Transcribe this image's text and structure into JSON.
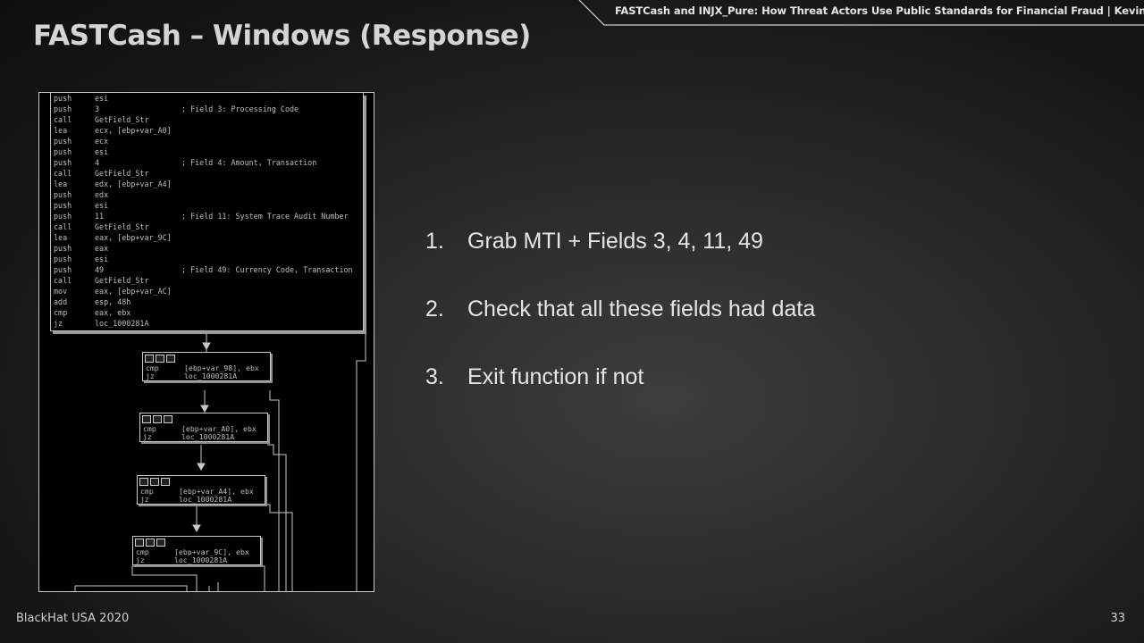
{
  "header": {
    "title": "FASTCash – Windows (Response)",
    "presentation_info": "FASTCash and INJX_Pure: How Threat Actors Use Public Standards for Financial Fraud | Kevin Perlow"
  },
  "footer": {
    "event": "BlackHat USA 2020",
    "page_number": "33"
  },
  "disassembly": {
    "main_block": [
      {
        "op": "push",
        "arg": "esi",
        "comment": ""
      },
      {
        "op": "push",
        "arg": "3",
        "comment": "; Field 3: Processing Code"
      },
      {
        "op": "call",
        "arg": "GetField_Str",
        "comment": ""
      },
      {
        "op": "lea",
        "arg": "ecx, [ebp+var_A0]",
        "comment": ""
      },
      {
        "op": "push",
        "arg": "ecx",
        "comment": ""
      },
      {
        "op": "push",
        "arg": "esi",
        "comment": ""
      },
      {
        "op": "push",
        "arg": "4",
        "comment": "; Field 4: Amount, Transaction"
      },
      {
        "op": "call",
        "arg": "GetField_Str",
        "comment": ""
      },
      {
        "op": "lea",
        "arg": "edx, [ebp+var_A4]",
        "comment": ""
      },
      {
        "op": "push",
        "arg": "edx",
        "comment": ""
      },
      {
        "op": "push",
        "arg": "esi",
        "comment": ""
      },
      {
        "op": "push",
        "arg": "11",
        "comment": "; Field 11: System Trace Audit Number"
      },
      {
        "op": "call",
        "arg": "GetField_Str",
        "comment": ""
      },
      {
        "op": "lea",
        "arg": "eax, [ebp+var_9C]",
        "comment": ""
      },
      {
        "op": "push",
        "arg": "eax",
        "comment": ""
      },
      {
        "op": "push",
        "arg": "esi",
        "comment": ""
      },
      {
        "op": "push",
        "arg": "49",
        "comment": "; Field 49: Currency Code, Transaction"
      },
      {
        "op": "call",
        "arg": "GetField_Str",
        "comment": ""
      },
      {
        "op": "mov",
        "arg": "eax, [ebp+var_AC]",
        "comment": ""
      },
      {
        "op": "add",
        "arg": "esp, 48h",
        "comment": ""
      },
      {
        "op": "cmp",
        "arg": "eax, ebx",
        "comment": ""
      },
      {
        "op": "jz",
        "arg": "loc_1000281A",
        "comment": ""
      }
    ],
    "nodes": [
      {
        "cmp": "cmp",
        "cmp_arg": "[ebp+var_98], ebx",
        "jz": "jz",
        "jz_arg": "loc_1000281A"
      },
      {
        "cmp": "cmp",
        "cmp_arg": "[ebp+var_A0], ebx",
        "jz": "jz",
        "jz_arg": "loc_1000281A"
      },
      {
        "cmp": "cmp",
        "cmp_arg": "[ebp+var_A4], ebx",
        "jz": "jz",
        "jz_arg": "loc_1000281A"
      },
      {
        "cmp": "cmp",
        "cmp_arg": "[ebp+var_9C], ebx",
        "jz": "jz",
        "jz_arg": "loc_1000281A"
      }
    ]
  },
  "steps": [
    {
      "number": "1.",
      "text": "Grab MTI + Fields 3, 4, 11, 49"
    },
    {
      "number": "2.",
      "text": "Check that all these fields had data"
    },
    {
      "number": "3.",
      "text": "Exit function if not"
    }
  ]
}
